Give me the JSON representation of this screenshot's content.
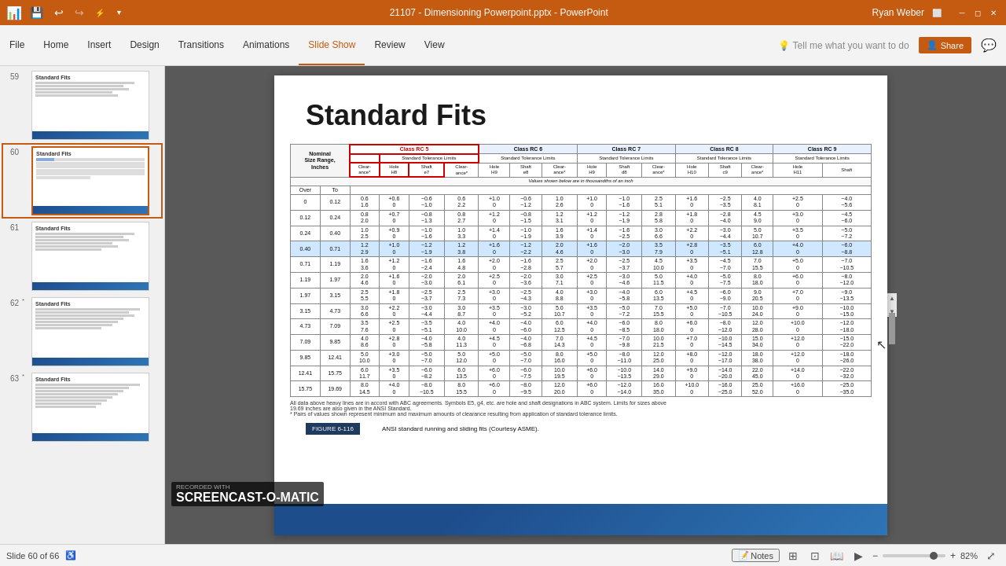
{
  "titlebar": {
    "title": "21107 - Dimensioning Powerpoint.pptx - PowerPoint",
    "user": "Ryan Weber"
  },
  "ribbon": {
    "tabs": [
      "File",
      "Home",
      "Insert",
      "Design",
      "Transitions",
      "Animations",
      "Slide Show",
      "Review",
      "View"
    ],
    "active_tab": "Slide Show",
    "search_placeholder": "Tell me what you want to do",
    "share_label": "Share"
  },
  "slide_panel": {
    "slides": [
      {
        "num": "59",
        "label": "Standard Fits"
      },
      {
        "num": "60",
        "label": "Standard Fits",
        "active": true
      },
      {
        "num": "61",
        "label": "Standard Fits"
      },
      {
        "num": "62",
        "label": "Standard Fits",
        "star": true
      },
      {
        "num": "63",
        "label": "Standard Fits",
        "star": true
      }
    ]
  },
  "main_slide": {
    "title": "Standard Fits",
    "figure_label": "FIGURE 6-116",
    "figure_caption": "ANSI standard running and sliding fits (Courtesy ASME).",
    "footnote1": "All data above heavy lines are in accord with ABC agreements. Symbols E5, g4, etc. are hole and shaft designations in ABC system. Limits for sizes above",
    "footnote2": "19.69 inches are also given in the ANSI Standard.",
    "footnote3": "* Pairs of values shown represent minimum and maximum amounts of clearance resulting from application of standard tolerance limits."
  },
  "status": {
    "slide_info": "Slide 60 of 66",
    "notes_label": "Notes",
    "zoom_level": "82%"
  }
}
